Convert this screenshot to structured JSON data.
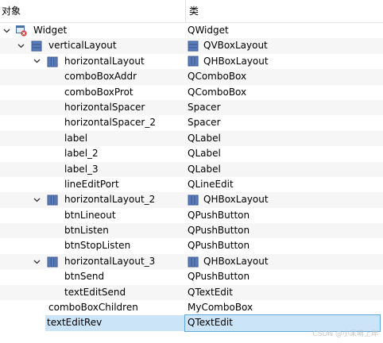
{
  "header": {
    "col_object": "对象",
    "col_class": "类"
  },
  "rows": [
    {
      "name": "Widget",
      "cls": "QWidget"
    },
    {
      "name": "verticalLayout",
      "cls": "QVBoxLayout"
    },
    {
      "name": "horizontalLayout",
      "cls": "QHBoxLayout"
    },
    {
      "name": "comboBoxAddr",
      "cls": "QComboBox"
    },
    {
      "name": "comboBoxProt",
      "cls": "QComboBox"
    },
    {
      "name": "horizontalSpacer",
      "cls": "Spacer"
    },
    {
      "name": "horizontalSpacer_2",
      "cls": "Spacer"
    },
    {
      "name": "label",
      "cls": "QLabel"
    },
    {
      "name": "label_2",
      "cls": "QLabel"
    },
    {
      "name": "label_3",
      "cls": "QLabel"
    },
    {
      "name": "lineEditPort",
      "cls": "QLineEdit"
    },
    {
      "name": "horizontalLayout_2",
      "cls": "QHBoxLayout"
    },
    {
      "name": "btnLineout",
      "cls": "QPushButton"
    },
    {
      "name": "btnListen",
      "cls": "QPushButton"
    },
    {
      "name": "btnStopListen",
      "cls": "QPushButton"
    },
    {
      "name": "horizontalLayout_3",
      "cls": "QHBoxLayout"
    },
    {
      "name": "btnSend",
      "cls": "QPushButton"
    },
    {
      "name": "textEditSend",
      "cls": "QTextEdit"
    },
    {
      "name": "comboBoxChildren",
      "cls": "MyComboBox"
    },
    {
      "name": "textEditRev",
      "cls": "QTextEdit"
    }
  ],
  "watermark": "CSDN @小呆萌上岸"
}
